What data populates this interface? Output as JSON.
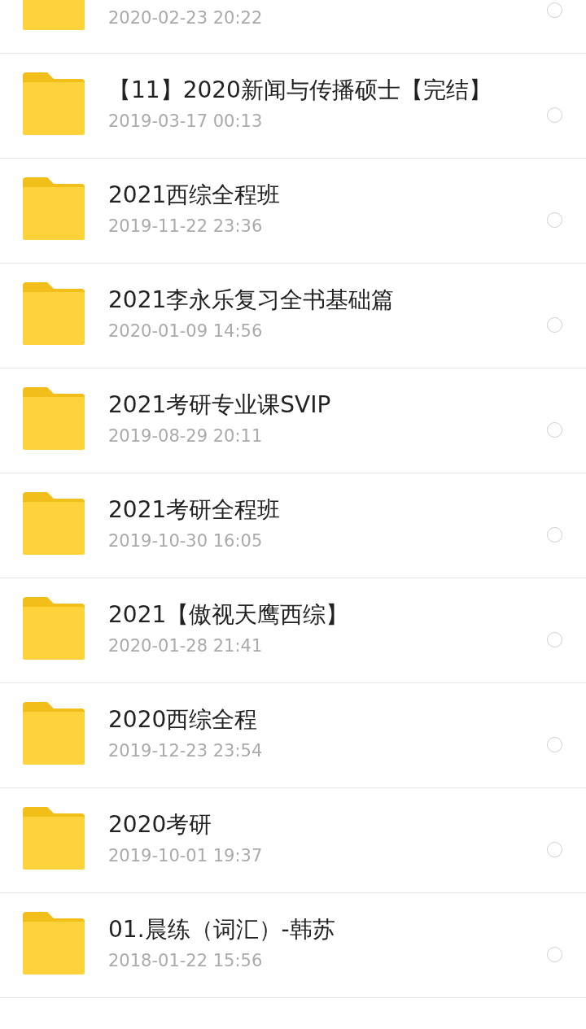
{
  "files": [
    {
      "date": "2020-02-23  20:22",
      "selected": false
    },
    {
      "name": "【11】2020新闻与传播硕士【完结】",
      "date": "2019-03-17  00:13",
      "selected": false
    },
    {
      "name": "2021西综全程班",
      "date": "2019-11-22  23:36",
      "selected": false
    },
    {
      "name": "2021李永乐复习全书基础篇",
      "date": "2020-01-09  14:56",
      "selected": false
    },
    {
      "name": "2021考研专业课SVIP",
      "date": "2019-08-29  20:11",
      "selected": false
    },
    {
      "name": "2021考研全程班",
      "date": "2019-10-30  16:05",
      "selected": false
    },
    {
      "name": "2021【傲视天鹰西综】",
      "date": "2020-01-28  21:41",
      "selected": false
    },
    {
      "name": "2020西综全程",
      "date": "2019-12-23  23:54",
      "selected": false
    },
    {
      "name": "2020考研",
      "date": "2019-10-01  19:37",
      "selected": false
    },
    {
      "name": "01.晨练（词汇）-韩苏",
      "date": "2018-01-22  15:56",
      "selected": false
    }
  ]
}
